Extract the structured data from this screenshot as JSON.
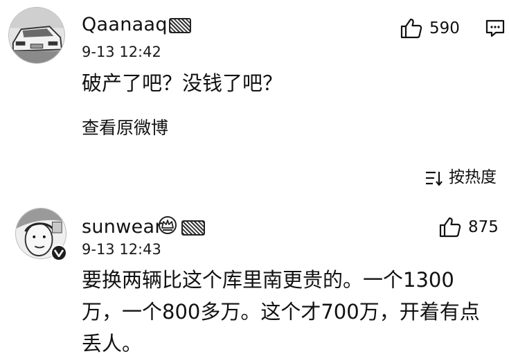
{
  "comment1": {
    "username": "Qaanaaq",
    "timestamp": "9-13 12:42",
    "likes": "590",
    "text": "破产了吧？没钱了吧？",
    "view_original": "查看原微博"
  },
  "sort": {
    "label": "按热度"
  },
  "comment2": {
    "username": "sunwear",
    "timestamp": "9-13 12:43",
    "likes": "875",
    "lines": [
      "要换两辆比这个库里南更贵的。一个1300",
      "万，一个800多万。这个才700万，开着有点",
      "丢人。"
    ]
  }
}
